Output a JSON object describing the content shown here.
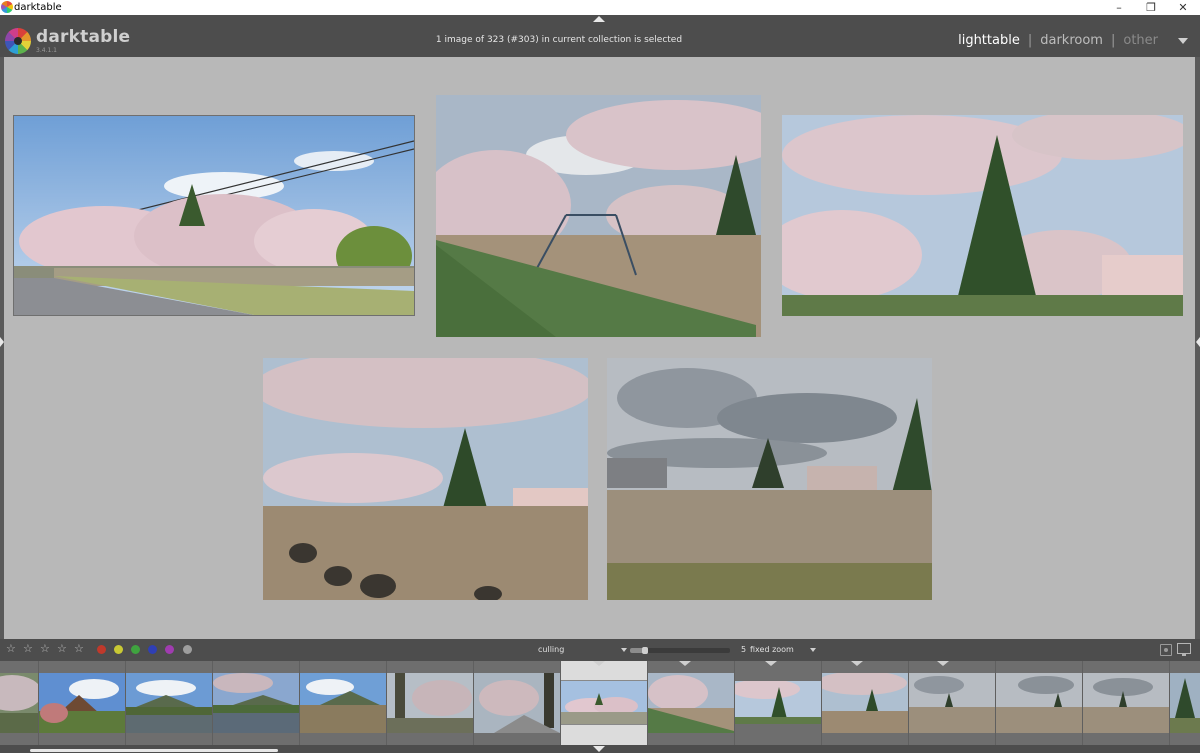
{
  "window": {
    "title": "darktable",
    "controls": {
      "minimize": "–",
      "maximize": "❐",
      "close": "✕"
    }
  },
  "header": {
    "logo_text": "darktable",
    "version": "3.4.1.1",
    "status": "1 image of 323 (#303) in current collection is selected",
    "views": {
      "lighttable": "lighttable",
      "darkroom": "darkroom",
      "other": "other",
      "separator": "|"
    }
  },
  "toolbar": {
    "star_glyph": "☆",
    "stars": 5,
    "color_labels": [
      "#c0392b",
      "#c9c934",
      "#3fa33f",
      "#2f3fb5",
      "#a03cb0",
      "#9e9e9e"
    ],
    "layout": "culling",
    "zoom_count": "5",
    "zoom_mode": "fixed zoom"
  },
  "culling": {
    "photos": [
      {
        "name": "photo-cherry-road",
        "selected": true
      },
      {
        "name": "photo-swings"
      },
      {
        "name": "photo-school-tree"
      },
      {
        "name": "photo-schoolyard-tires"
      },
      {
        "name": "photo-cloudy-field"
      }
    ]
  },
  "filmstrip": {
    "selected_index": 6,
    "thumbs": [
      "cherry-house",
      "mountain-bushes",
      "lake-mountain",
      "lake-trees",
      "mountain-field",
      "tree-path",
      "tree-road",
      "cherry-road",
      "swings",
      "school-tree",
      "school-fence",
      "cloud-field",
      "cloud-field-2",
      "tree-edge"
    ]
  }
}
